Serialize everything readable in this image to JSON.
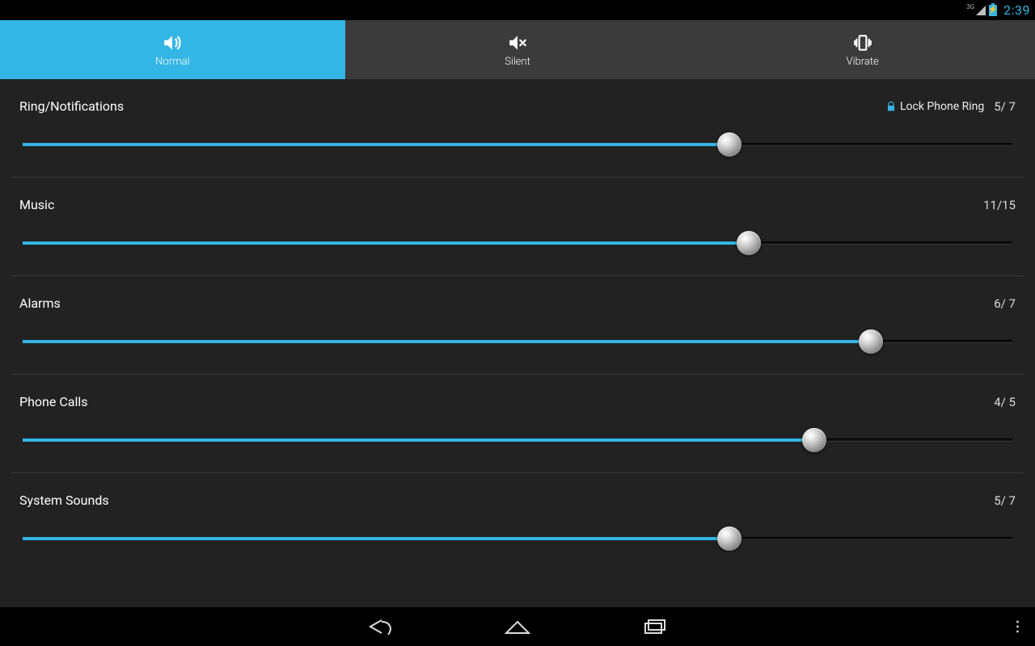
{
  "statusbar": {
    "network": "3G",
    "time": "2:39"
  },
  "tabs": {
    "normal": {
      "label": "Normal"
    },
    "silent": {
      "label": "Silent"
    },
    "vibrate": {
      "label": "Vibrate"
    }
  },
  "lock_label": "Lock Phone Ring",
  "sliders": {
    "ring": {
      "title": "Ring/Notifications",
      "value": 5,
      "max": 7,
      "display": "5/ 7"
    },
    "music": {
      "title": "Music",
      "value": 11,
      "max": 15,
      "display": "11/15"
    },
    "alarms": {
      "title": "Alarms",
      "value": 6,
      "max": 7,
      "display": "6/ 7"
    },
    "calls": {
      "title": "Phone Calls",
      "value": 4,
      "max": 5,
      "display": "4/ 5"
    },
    "system": {
      "title": "System Sounds",
      "value": 5,
      "max": 7,
      "display": "5/ 7"
    }
  }
}
